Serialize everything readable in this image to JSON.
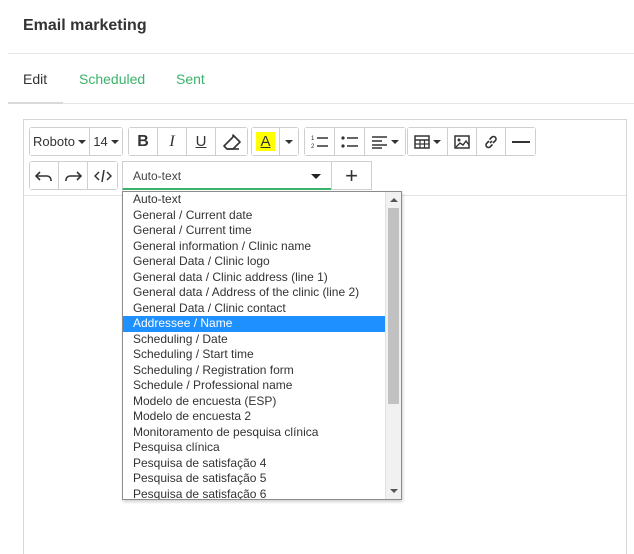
{
  "page": {
    "title": "Email marketing"
  },
  "tabs": [
    {
      "label": "Edit",
      "active": true
    },
    {
      "label": "Scheduled",
      "active": false
    },
    {
      "label": "Sent",
      "active": false
    }
  ],
  "toolbar": {
    "font_family": "Roboto",
    "font_size": "14",
    "bold": "B",
    "italic": "I",
    "underline": "U",
    "text_color": "A",
    "highlight_color": "#ffff00",
    "accent_color": "#3bb36b",
    "icons": [
      "eraser-icon",
      "ordered-list-icon",
      "unordered-list-icon",
      "align-icon",
      "table-icon",
      "image-icon",
      "link-icon",
      "horizontal-rule-icon",
      "undo-icon",
      "redo-icon",
      "code-view-icon",
      "plus-icon"
    ]
  },
  "autotext": {
    "selected_value": "Auto-text",
    "add_label": "+",
    "highlighted": "Addressee / Name",
    "options": [
      "Auto-text",
      "General / Current date",
      "General / Current time",
      "General information / Clinic name",
      "General Data / Clinic logo",
      "General data / Clinic address (line 1)",
      "General data / Address of the clinic (line 2)",
      "General Data / Clinic contact",
      "Addressee / Name",
      "Scheduling / Date",
      "Scheduling / Start time",
      "Scheduling / Registration form",
      "Schedule / Professional name",
      "Modelo de encuesta (ESP)",
      "Modelo de encuesta 2",
      "Monitoramento de pesquisa clínica",
      "Pesquisa clínica",
      "Pesquisa de satisfação 4",
      "Pesquisa de satisfação 5",
      "Pesquisa de satisfação 6"
    ]
  }
}
